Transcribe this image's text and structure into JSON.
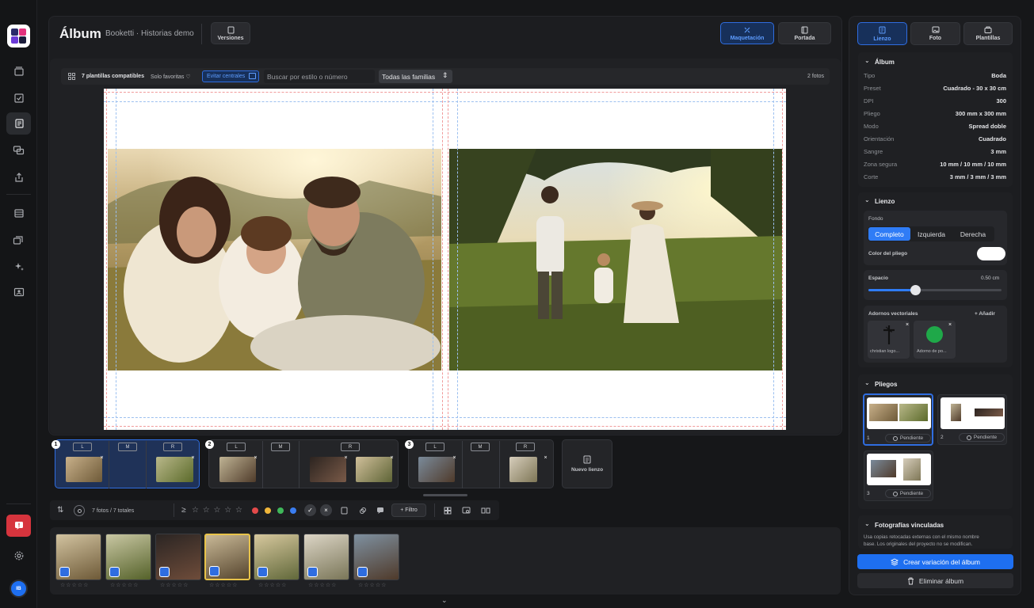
{
  "header": {
    "title": "Álbum",
    "subtitle": "Booketti · Historias demo",
    "versions_label": "Versiones",
    "layout_label": "Maquetación",
    "cover_label": "Portada"
  },
  "toolbar": {
    "compatible": "7 plantillas compatibles",
    "favorites": "Solo favoritas",
    "avoid": "Evitar centrales",
    "search_placeholder": "Buscar por estilo o número",
    "families": "Todas las familias",
    "photo_count": "2 fotos"
  },
  "pages": [
    {
      "num": "1",
      "left": "L",
      "mid": "M",
      "right": "R"
    },
    {
      "num": "2",
      "left": "L",
      "mid": "M",
      "right": "R"
    },
    {
      "num": "3",
      "left": "L",
      "mid": "M",
      "right": "R"
    }
  ],
  "new_canvas": "Nuevo lienzo",
  "filter": {
    "count": "7 fotos / 7 totales",
    "gte": "≥",
    "stars": "☆ ☆ ☆ ☆ ☆",
    "filter_label": "+ Filtro",
    "colors": [
      "#e34a4a",
      "#f0b63a",
      "#3fb85a",
      "#3a7df0"
    ]
  },
  "strip": {
    "stars": "☆☆☆☆☆"
  },
  "sidebar": {
    "tabs": [
      "Lienzo",
      "Foto",
      "Plantillas"
    ],
    "album": {
      "title": "Álbum",
      "rows": [
        {
          "label": "Tipo",
          "value": "Boda"
        },
        {
          "label": "Preset",
          "value": "Cuadrado - 30 x 30 cm"
        },
        {
          "label": "DPI",
          "value": "300"
        },
        {
          "label": "Pliego",
          "value": "300 mm x 300 mm"
        },
        {
          "label": "Modo",
          "value": "Spread doble"
        },
        {
          "label": "Orientación",
          "value": "Cuadrado"
        },
        {
          "label": "Sangre",
          "value": "3 mm"
        },
        {
          "label": "Zona segura",
          "value": "10 mm / 10 mm / 10 mm"
        },
        {
          "label": "Corte",
          "value": "3 mm / 3 mm / 3 mm"
        }
      ]
    },
    "lienzo": {
      "title": "Lienzo",
      "fondo": "Fondo",
      "seg": [
        "Completo",
        "Izquierda",
        "Derecha"
      ],
      "color_label": "Color del pliego",
      "espacio": "Espacio",
      "espacio_value": "0.50 cm",
      "espacio_fraction": 0.35,
      "adornos": "Adornos vectoriales",
      "add": "+ Añadir",
      "ornaments": [
        "christian logo...",
        "Adorno de po..."
      ]
    },
    "pliegos": {
      "title": "Pliegos",
      "items": [
        {
          "num": "1",
          "status": "Pendiente"
        },
        {
          "num": "2",
          "status": "Pendiente"
        },
        {
          "num": "3",
          "status": "Pendiente"
        }
      ]
    },
    "linked": {
      "title": "Fotografías vinculadas",
      "desc1": "Usa copias retocadas externas con el mismo nombre",
      "desc2": "base. Los originales del proyecto no se modifican."
    },
    "create_btn": "Crear variación del álbum",
    "delete_btn": "Eliminar álbum"
  },
  "user": {
    "initials": "IB"
  }
}
